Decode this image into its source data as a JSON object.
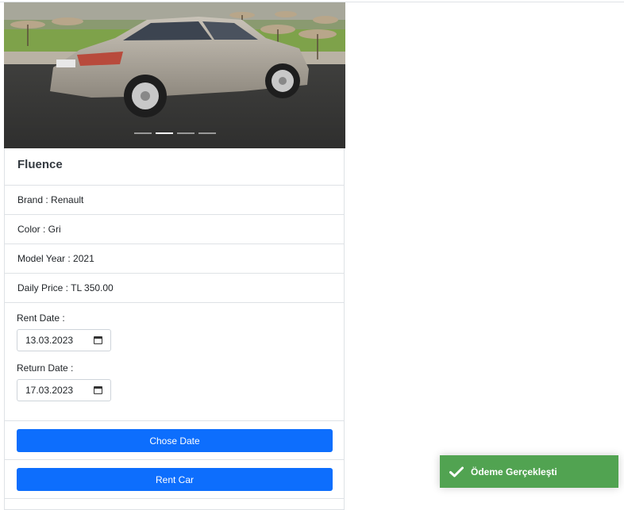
{
  "car": {
    "name": "Fluence",
    "details": [
      "Brand : Renault",
      "Color : Gri",
      "Model Year : 2021",
      "Daily Price : TL 350.00"
    ]
  },
  "carousel": {
    "slides": 4,
    "active_index": 1
  },
  "form": {
    "rent_label": "Rent Date :",
    "rent_value": "13.03.2023",
    "return_label": "Return Date :",
    "return_value": "17.03.2023"
  },
  "buttons": {
    "chose_date": "Chose Date",
    "rent_car": "Rent Car"
  },
  "toast": {
    "message": "Ödeme Gerçekleşti",
    "icon": "check-icon",
    "color": "#51a351"
  },
  "colors": {
    "primary": "#0d6efd",
    "border": "#dee2e6"
  }
}
